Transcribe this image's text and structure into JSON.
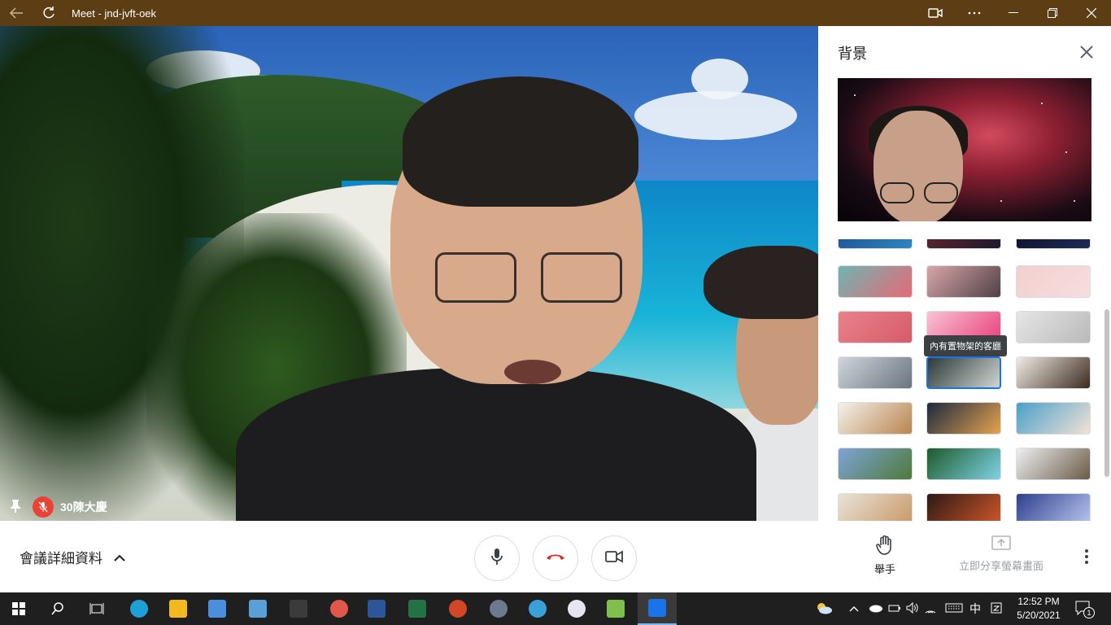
{
  "window": {
    "title": "Meet - jnd-jvft-oek",
    "accent": "#5c3d14"
  },
  "video": {
    "participant_name": "30陳大慶"
  },
  "panel": {
    "title": "背景",
    "tooltip": "內有置物架的客廳"
  },
  "thumbnails": [
    {
      "c1": "#1a4d8a",
      "c2": "#2e86c1"
    },
    {
      "c1": "#6b2530",
      "c2": "#1a1a2e"
    },
    {
      "c1": "#0f0f2a",
      "c2": "#1d2b55"
    },
    {
      "c1": "#6fb4b0",
      "c2": "#e66a77"
    },
    {
      "c1": "#d8a6a6",
      "c2": "#4f4048"
    },
    {
      "c1": "#f2cfcd",
      "c2": "#f6dede"
    },
    {
      "c1": "#e9818b",
      "c2": "#d65c69"
    },
    {
      "c1": "#f9c3d5",
      "c2": "#e93f7a"
    },
    {
      "c1": "#e6e6e6",
      "c2": "#b9b9b9"
    },
    {
      "c1": "#cfd6dc",
      "c2": "#6a7480"
    },
    {
      "c1": "#2c3a38",
      "c2": "#cfd6d2"
    },
    {
      "c1": "#f1ece6",
      "c2": "#3d2a1e"
    },
    {
      "c1": "#f4f1ec",
      "c2": "#b9854e"
    },
    {
      "c1": "#1b2a3e",
      "c2": "#e7a24f"
    },
    {
      "c1": "#4aa0c9",
      "c2": "#f2e1d6"
    },
    {
      "c1": "#7ea4d6",
      "c2": "#4e7a3a"
    },
    {
      "c1": "#1d5a2a",
      "c2": "#7fd2e6"
    },
    {
      "c1": "#eef0f2",
      "c2": "#6b5a46"
    },
    {
      "c1": "#e9e2d8",
      "c2": "#c99866"
    },
    {
      "c1": "#2b1a14",
      "c2": "#d2562a"
    },
    {
      "c1": "#2e3f8c",
      "c2": "#b9c6f0"
    }
  ],
  "bottom": {
    "details_label": "會議詳細資料",
    "raise_hand_label": "舉手",
    "present_label": "立即分享螢幕畫面"
  },
  "taskbar": {
    "time": "12:52 PM",
    "date": "5/20/2021",
    "ime": "中",
    "notif_count": "1",
    "icons": [
      "windows-start-icon",
      "search-icon",
      "task-view-icon",
      "edge-icon",
      "file-explorer-icon",
      "store-icon",
      "control-panel-icon",
      "terminal-icon",
      "paint-icon",
      "word-icon",
      "excel-icon",
      "powerpoint-icon",
      "settings-icon",
      "photos-icon",
      "itunes-icon",
      "notepad-icon",
      "meet-icon"
    ]
  }
}
